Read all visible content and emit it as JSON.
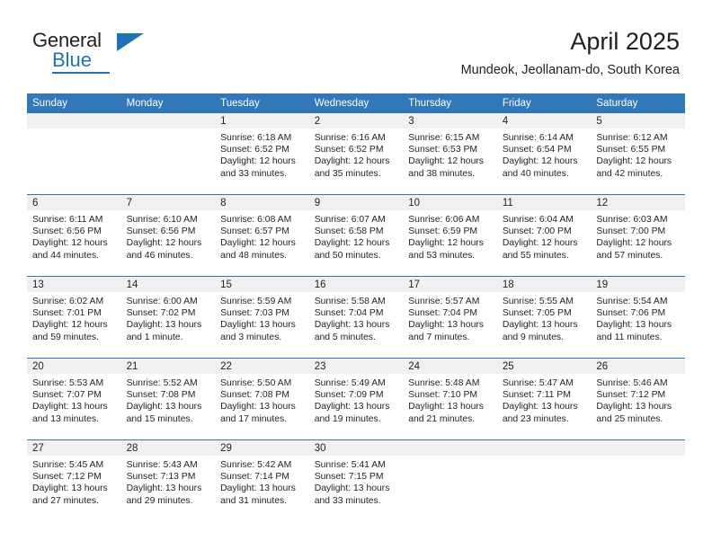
{
  "brand": {
    "name_top": "General",
    "name_bottom": "Blue",
    "accent_color": "#1f71b8",
    "triangle_icon": "triangle-icon"
  },
  "header": {
    "month_title": "April 2025",
    "location": "Mundeok, Jeollanam-do, South Korea"
  },
  "theme": {
    "header_blue": "#3277b7",
    "band_gray": "#f0f0f0",
    "text_color": "#231f20"
  },
  "weekday_headers": [
    "Sunday",
    "Monday",
    "Tuesday",
    "Wednesday",
    "Thursday",
    "Friday",
    "Saturday"
  ],
  "weeks": [
    [
      {
        "day": "",
        "sunrise": "",
        "sunset": "",
        "daylight_line1": "",
        "daylight_line2": ""
      },
      {
        "day": "",
        "sunrise": "",
        "sunset": "",
        "daylight_line1": "",
        "daylight_line2": ""
      },
      {
        "day": "1",
        "sunrise": "Sunrise: 6:18 AM",
        "sunset": "Sunset: 6:52 PM",
        "daylight_line1": "Daylight: 12 hours",
        "daylight_line2": "and 33 minutes."
      },
      {
        "day": "2",
        "sunrise": "Sunrise: 6:16 AM",
        "sunset": "Sunset: 6:52 PM",
        "daylight_line1": "Daylight: 12 hours",
        "daylight_line2": "and 35 minutes."
      },
      {
        "day": "3",
        "sunrise": "Sunrise: 6:15 AM",
        "sunset": "Sunset: 6:53 PM",
        "daylight_line1": "Daylight: 12 hours",
        "daylight_line2": "and 38 minutes."
      },
      {
        "day": "4",
        "sunrise": "Sunrise: 6:14 AM",
        "sunset": "Sunset: 6:54 PM",
        "daylight_line1": "Daylight: 12 hours",
        "daylight_line2": "and 40 minutes."
      },
      {
        "day": "5",
        "sunrise": "Sunrise: 6:12 AM",
        "sunset": "Sunset: 6:55 PM",
        "daylight_line1": "Daylight: 12 hours",
        "daylight_line2": "and 42 minutes."
      }
    ],
    [
      {
        "day": "6",
        "sunrise": "Sunrise: 6:11 AM",
        "sunset": "Sunset: 6:56 PM",
        "daylight_line1": "Daylight: 12 hours",
        "daylight_line2": "and 44 minutes."
      },
      {
        "day": "7",
        "sunrise": "Sunrise: 6:10 AM",
        "sunset": "Sunset: 6:56 PM",
        "daylight_line1": "Daylight: 12 hours",
        "daylight_line2": "and 46 minutes."
      },
      {
        "day": "8",
        "sunrise": "Sunrise: 6:08 AM",
        "sunset": "Sunset: 6:57 PM",
        "daylight_line1": "Daylight: 12 hours",
        "daylight_line2": "and 48 minutes."
      },
      {
        "day": "9",
        "sunrise": "Sunrise: 6:07 AM",
        "sunset": "Sunset: 6:58 PM",
        "daylight_line1": "Daylight: 12 hours",
        "daylight_line2": "and 50 minutes."
      },
      {
        "day": "10",
        "sunrise": "Sunrise: 6:06 AM",
        "sunset": "Sunset: 6:59 PM",
        "daylight_line1": "Daylight: 12 hours",
        "daylight_line2": "and 53 minutes."
      },
      {
        "day": "11",
        "sunrise": "Sunrise: 6:04 AM",
        "sunset": "Sunset: 7:00 PM",
        "daylight_line1": "Daylight: 12 hours",
        "daylight_line2": "and 55 minutes."
      },
      {
        "day": "12",
        "sunrise": "Sunrise: 6:03 AM",
        "sunset": "Sunset: 7:00 PM",
        "daylight_line1": "Daylight: 12 hours",
        "daylight_line2": "and 57 minutes."
      }
    ],
    [
      {
        "day": "13",
        "sunrise": "Sunrise: 6:02 AM",
        "sunset": "Sunset: 7:01 PM",
        "daylight_line1": "Daylight: 12 hours",
        "daylight_line2": "and 59 minutes."
      },
      {
        "day": "14",
        "sunrise": "Sunrise: 6:00 AM",
        "sunset": "Sunset: 7:02 PM",
        "daylight_line1": "Daylight: 13 hours",
        "daylight_line2": "and 1 minute."
      },
      {
        "day": "15",
        "sunrise": "Sunrise: 5:59 AM",
        "sunset": "Sunset: 7:03 PM",
        "daylight_line1": "Daylight: 13 hours",
        "daylight_line2": "and 3 minutes."
      },
      {
        "day": "16",
        "sunrise": "Sunrise: 5:58 AM",
        "sunset": "Sunset: 7:04 PM",
        "daylight_line1": "Daylight: 13 hours",
        "daylight_line2": "and 5 minutes."
      },
      {
        "day": "17",
        "sunrise": "Sunrise: 5:57 AM",
        "sunset": "Sunset: 7:04 PM",
        "daylight_line1": "Daylight: 13 hours",
        "daylight_line2": "and 7 minutes."
      },
      {
        "day": "18",
        "sunrise": "Sunrise: 5:55 AM",
        "sunset": "Sunset: 7:05 PM",
        "daylight_line1": "Daylight: 13 hours",
        "daylight_line2": "and 9 minutes."
      },
      {
        "day": "19",
        "sunrise": "Sunrise: 5:54 AM",
        "sunset": "Sunset: 7:06 PM",
        "daylight_line1": "Daylight: 13 hours",
        "daylight_line2": "and 11 minutes."
      }
    ],
    [
      {
        "day": "20",
        "sunrise": "Sunrise: 5:53 AM",
        "sunset": "Sunset: 7:07 PM",
        "daylight_line1": "Daylight: 13 hours",
        "daylight_line2": "and 13 minutes."
      },
      {
        "day": "21",
        "sunrise": "Sunrise: 5:52 AM",
        "sunset": "Sunset: 7:08 PM",
        "daylight_line1": "Daylight: 13 hours",
        "daylight_line2": "and 15 minutes."
      },
      {
        "day": "22",
        "sunrise": "Sunrise: 5:50 AM",
        "sunset": "Sunset: 7:08 PM",
        "daylight_line1": "Daylight: 13 hours",
        "daylight_line2": "and 17 minutes."
      },
      {
        "day": "23",
        "sunrise": "Sunrise: 5:49 AM",
        "sunset": "Sunset: 7:09 PM",
        "daylight_line1": "Daylight: 13 hours",
        "daylight_line2": "and 19 minutes."
      },
      {
        "day": "24",
        "sunrise": "Sunrise: 5:48 AM",
        "sunset": "Sunset: 7:10 PM",
        "daylight_line1": "Daylight: 13 hours",
        "daylight_line2": "and 21 minutes."
      },
      {
        "day": "25",
        "sunrise": "Sunrise: 5:47 AM",
        "sunset": "Sunset: 7:11 PM",
        "daylight_line1": "Daylight: 13 hours",
        "daylight_line2": "and 23 minutes."
      },
      {
        "day": "26",
        "sunrise": "Sunrise: 5:46 AM",
        "sunset": "Sunset: 7:12 PM",
        "daylight_line1": "Daylight: 13 hours",
        "daylight_line2": "and 25 minutes."
      }
    ],
    [
      {
        "day": "27",
        "sunrise": "Sunrise: 5:45 AM",
        "sunset": "Sunset: 7:12 PM",
        "daylight_line1": "Daylight: 13 hours",
        "daylight_line2": "and 27 minutes."
      },
      {
        "day": "28",
        "sunrise": "Sunrise: 5:43 AM",
        "sunset": "Sunset: 7:13 PM",
        "daylight_line1": "Daylight: 13 hours",
        "daylight_line2": "and 29 minutes."
      },
      {
        "day": "29",
        "sunrise": "Sunrise: 5:42 AM",
        "sunset": "Sunset: 7:14 PM",
        "daylight_line1": "Daylight: 13 hours",
        "daylight_line2": "and 31 minutes."
      },
      {
        "day": "30",
        "sunrise": "Sunrise: 5:41 AM",
        "sunset": "Sunset: 7:15 PM",
        "daylight_line1": "Daylight: 13 hours",
        "daylight_line2": "and 33 minutes."
      },
      {
        "day": "",
        "sunrise": "",
        "sunset": "",
        "daylight_line1": "",
        "daylight_line2": ""
      },
      {
        "day": "",
        "sunrise": "",
        "sunset": "",
        "daylight_line1": "",
        "daylight_line2": ""
      },
      {
        "day": "",
        "sunrise": "",
        "sunset": "",
        "daylight_line1": "",
        "daylight_line2": ""
      }
    ]
  ]
}
